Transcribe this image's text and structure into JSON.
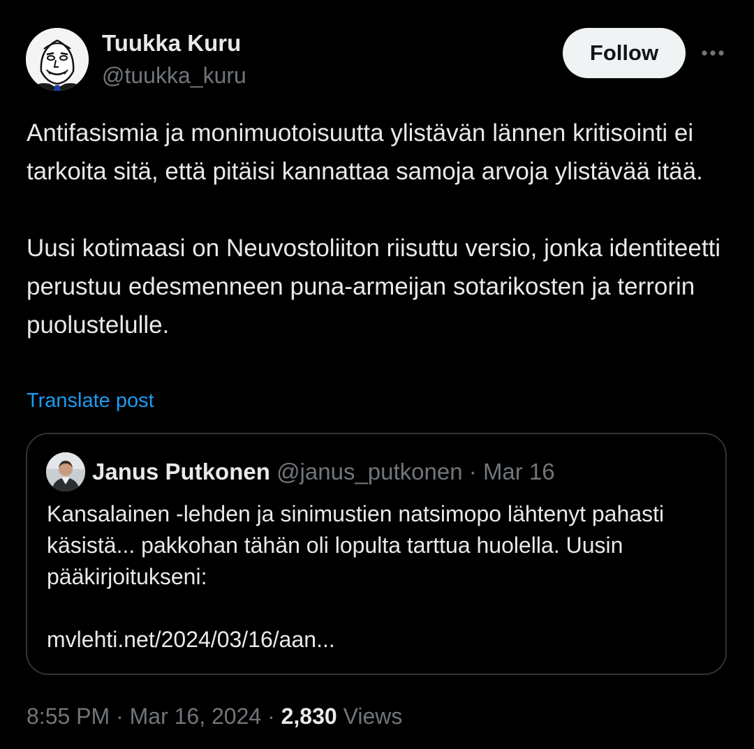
{
  "author": {
    "display_name": "Tuukka Kuru",
    "handle": "@tuukka_kuru",
    "avatar_icon": "cartoon-face-avatar"
  },
  "actions": {
    "follow_label": "Follow",
    "more_icon": "more-dots-icon"
  },
  "post": {
    "paragraphs": [
      "Antifasismia ja monimuotoisuutta ylistävän lännen kritisointi ei tarkoita sitä, että pitäisi kannattaa samoja arvoja ylistävää itää.",
      "Uusi kotimaasi on Neuvostoliiton riisuttu versio, jonka identiteetti perustuu edesmenneen puna-armeijan sotarikosten ja terrorin puolustelulle."
    ],
    "translate_label": "Translate post"
  },
  "quoted_post": {
    "display_name": "Janus Putkonen",
    "handle": "@janus_putkonen",
    "separator": "·",
    "date": "Mar 16",
    "paragraphs": [
      "Kansalainen -lehden ja sinimustien natsimopo lähtenyt pahasti käsistä... pakkohan tähän oli lopulta tarttua huolella. Uusin pääkirjoitukseni:",
      "mvlehti.net/2024/03/16/aan..."
    ]
  },
  "meta": {
    "time": "8:55 PM",
    "separator": "·",
    "date": "Mar 16, 2024",
    "views_count": "2,830",
    "views_label": "Views"
  },
  "colors": {
    "background": "#000000",
    "text": "#e7e9ea",
    "secondary": "#71767b",
    "link": "#1d9bf0",
    "border": "#2f3336",
    "button_bg": "#eff3f4"
  }
}
